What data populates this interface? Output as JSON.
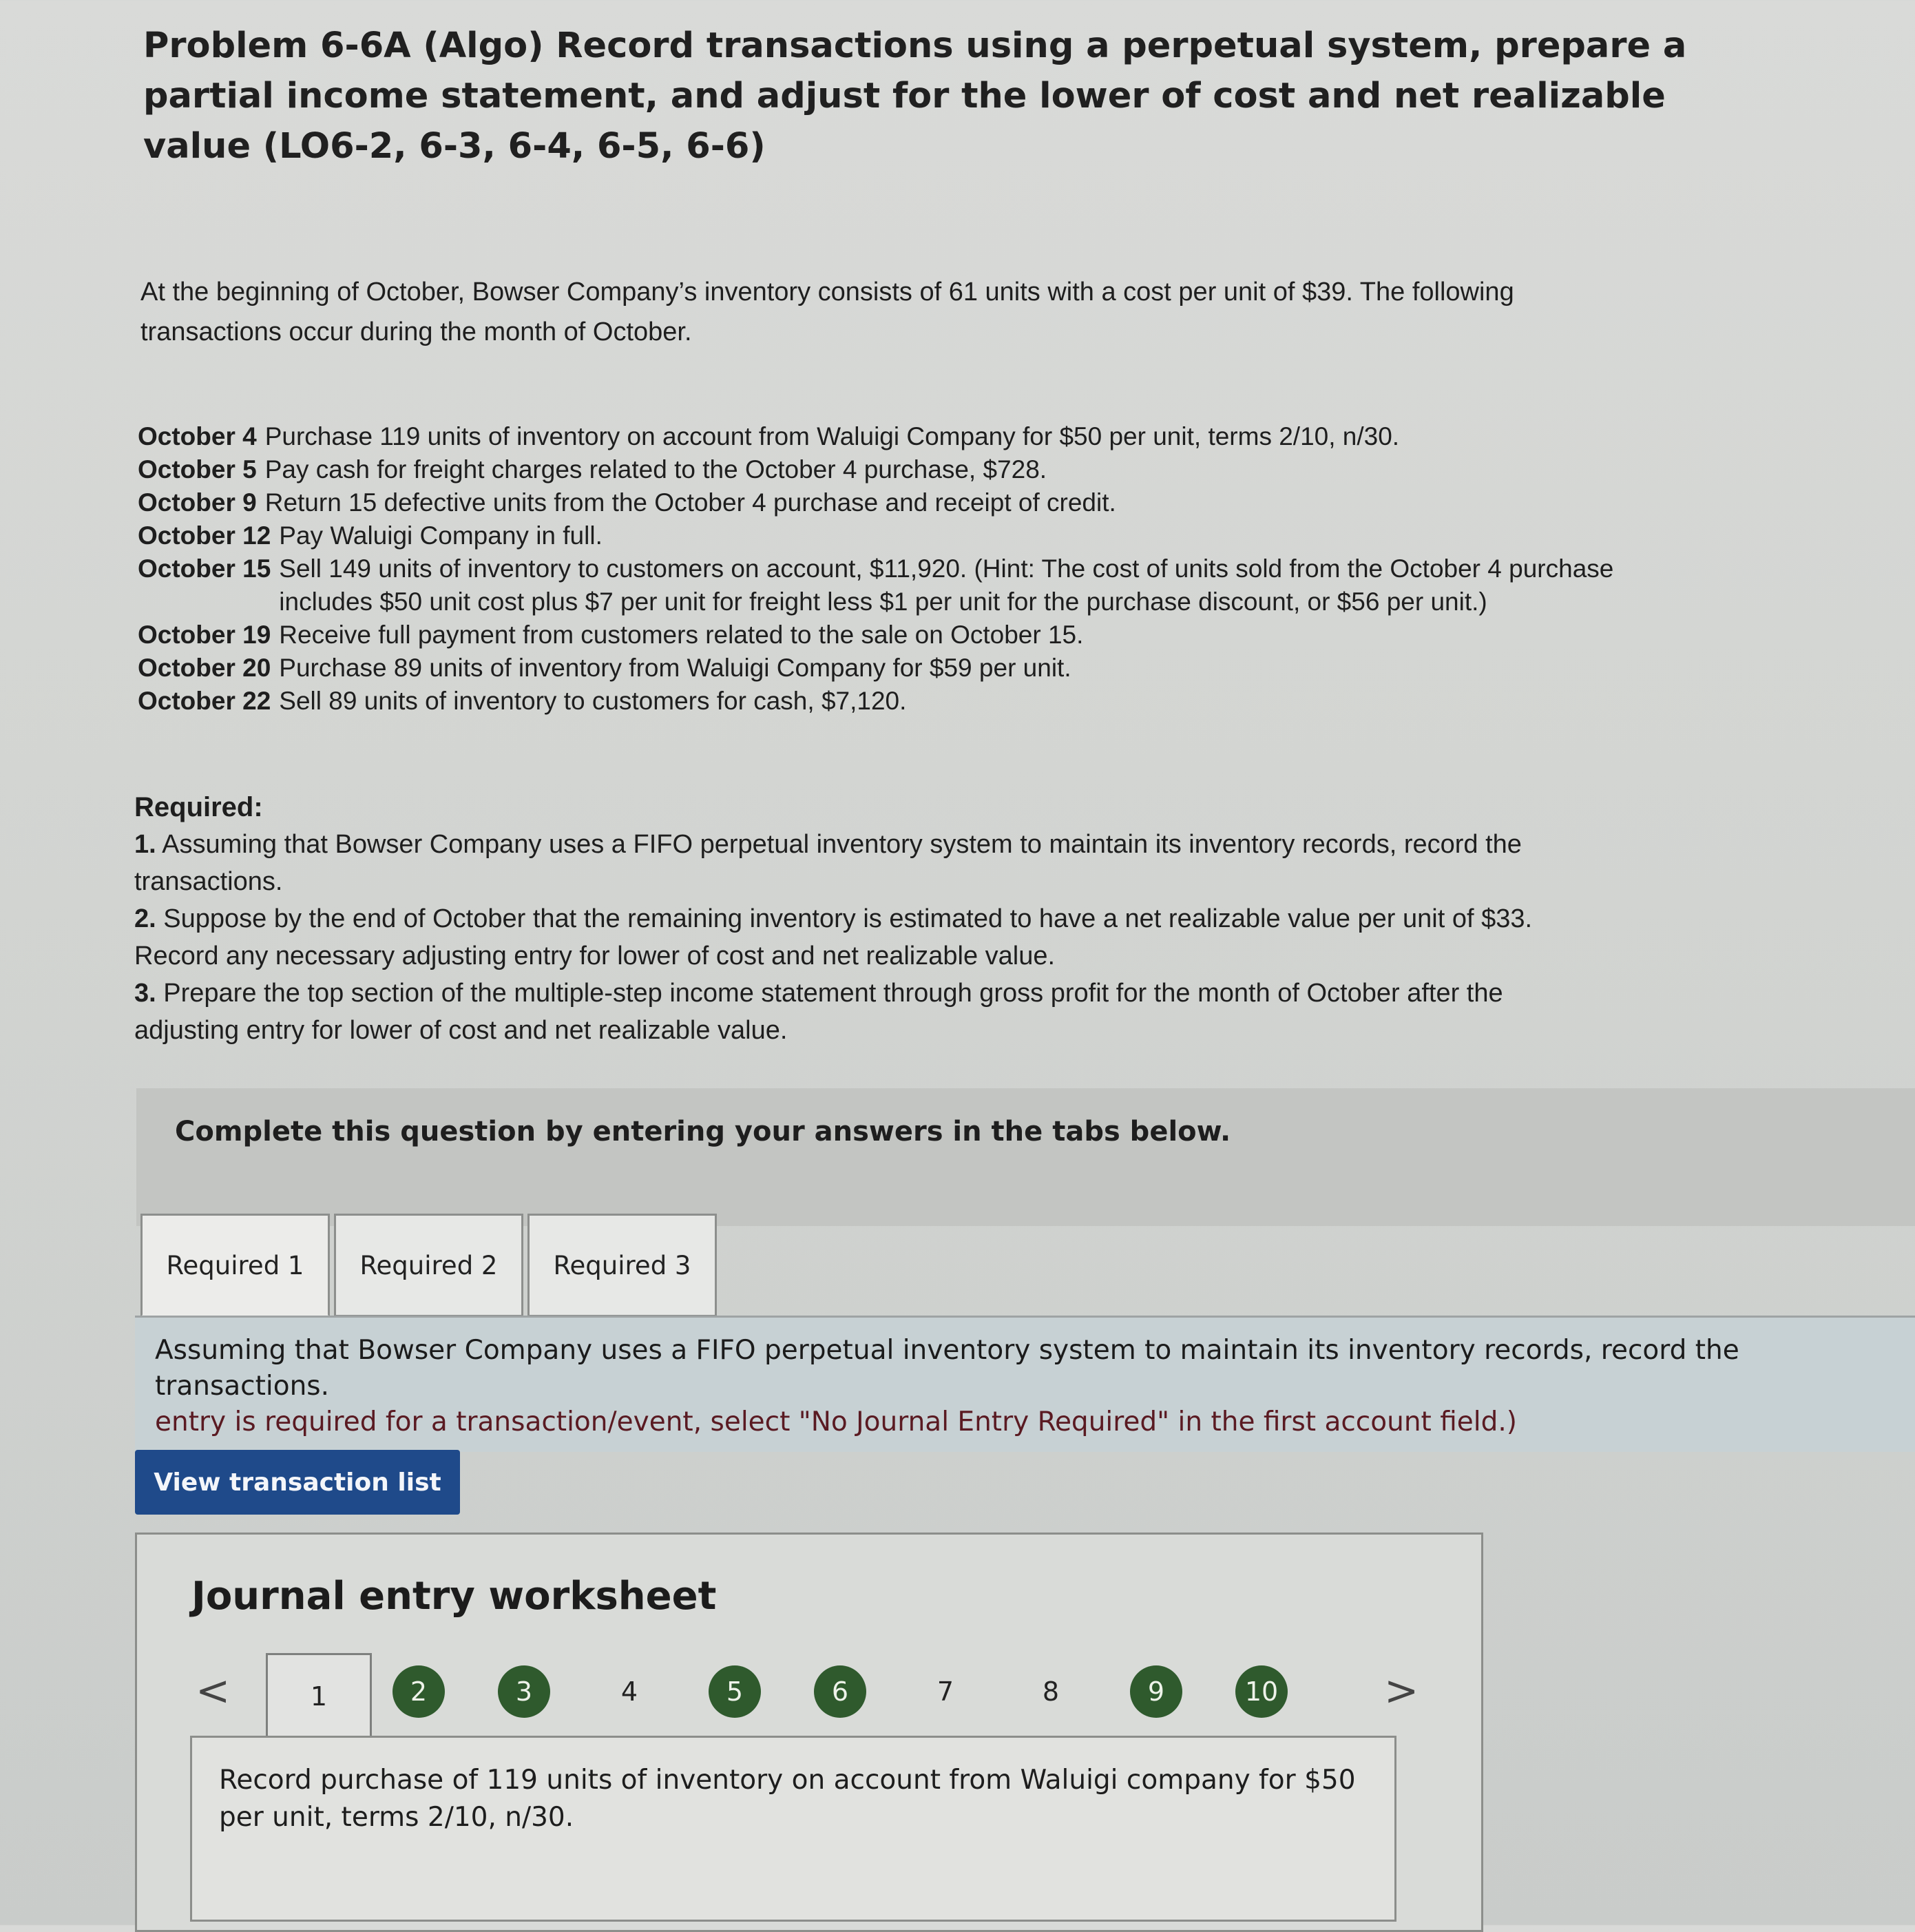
{
  "title": "Problem 6-6A (Algo) Record transactions using a perpetual system, prepare a partial income statement, and adjust for the lower of cost and net realizable value (LO6-2, 6-3, 6-4, 6-5, 6-6)",
  "intro": "At the beginning of October, Bowser Company’s inventory consists of 61 units with a cost per unit of $39. The following transactions occur during the month of October.",
  "transactions": [
    {
      "date": "October 4",
      "text": "Purchase 119 units of inventory on account from Waluigi Company for $50 per unit, terms 2/10, n/30."
    },
    {
      "date": "October 5",
      "text": "Pay cash for freight charges related to the October 4 purchase, $728."
    },
    {
      "date": "October 9",
      "text": "Return 15 defective units from the October 4 purchase and receipt of credit."
    },
    {
      "date": "October 12",
      "text": "Pay Waluigi Company in full."
    },
    {
      "date": "October 15",
      "text": "Sell 149 units of inventory to customers on account, $11,920. (Hint: The cost of units sold from the October 4 purchase includes $50 unit cost plus $7 per unit for freight less $1 per unit for the purchase discount, or $56 per unit.)"
    },
    {
      "date": "October 19",
      "text": "Receive full payment from customers related to the sale on October 15."
    },
    {
      "date": "October 20",
      "text": "Purchase 89 units of inventory from Waluigi Company for $59 per unit."
    },
    {
      "date": "October 22",
      "text": "Sell 89 units of inventory to customers for cash, $7,120."
    }
  ],
  "required": {
    "heading": "Required:",
    "items": [
      {
        "num": "1.",
        "text": "Assuming that Bowser Company uses a FIFO perpetual inventory system to maintain its inventory records, record the transactions."
      },
      {
        "num": "2.",
        "text": "Suppose by the end of October that the remaining inventory is estimated to have a net realizable value per unit of $33. Record any necessary adjusting entry for lower of cost and net realizable value."
      },
      {
        "num": "3.",
        "text": "Prepare the top section of the multiple-step income statement through gross profit for the month of October after the adjusting entry for lower of cost and net realizable value."
      }
    ]
  },
  "instruction": "Complete this question by entering your answers in the tabs below.",
  "tabs": [
    {
      "label": "Required 1",
      "active": true
    },
    {
      "label": "Required 2",
      "active": false
    },
    {
      "label": "Required 3",
      "active": false
    }
  ],
  "panel": {
    "line1": "Assuming that Bowser Company uses a FIFO perpetual inventory system to maintain its inventory records, record the transactions.",
    "line2": "entry is required for a transaction/event, select \"No Journal Entry Required\" in the first account field.)"
  },
  "view_button": "View transaction list",
  "worksheet": {
    "title": "Journal entry worksheet",
    "prev_arrow": "<",
    "next_arrow": ">",
    "pages": [
      {
        "label": "1",
        "state": "current"
      },
      {
        "label": "2",
        "state": "done"
      },
      {
        "label": "3",
        "state": "done"
      },
      {
        "label": "4",
        "state": "todo"
      },
      {
        "label": "5",
        "state": "done"
      },
      {
        "label": "6",
        "state": "done"
      },
      {
        "label": "7",
        "state": "todo"
      },
      {
        "label": "8",
        "state": "todo"
      },
      {
        "label": "9",
        "state": "done"
      },
      {
        "label": "10",
        "state": "done"
      }
    ],
    "prompt": "Record purchase of 119 units of inventory on account from Waluigi company for $50 per unit, terms 2/10, n/30."
  },
  "colors": {
    "button_blue": "#1f4a8a",
    "page_done_green": "#2f5a2d"
  }
}
